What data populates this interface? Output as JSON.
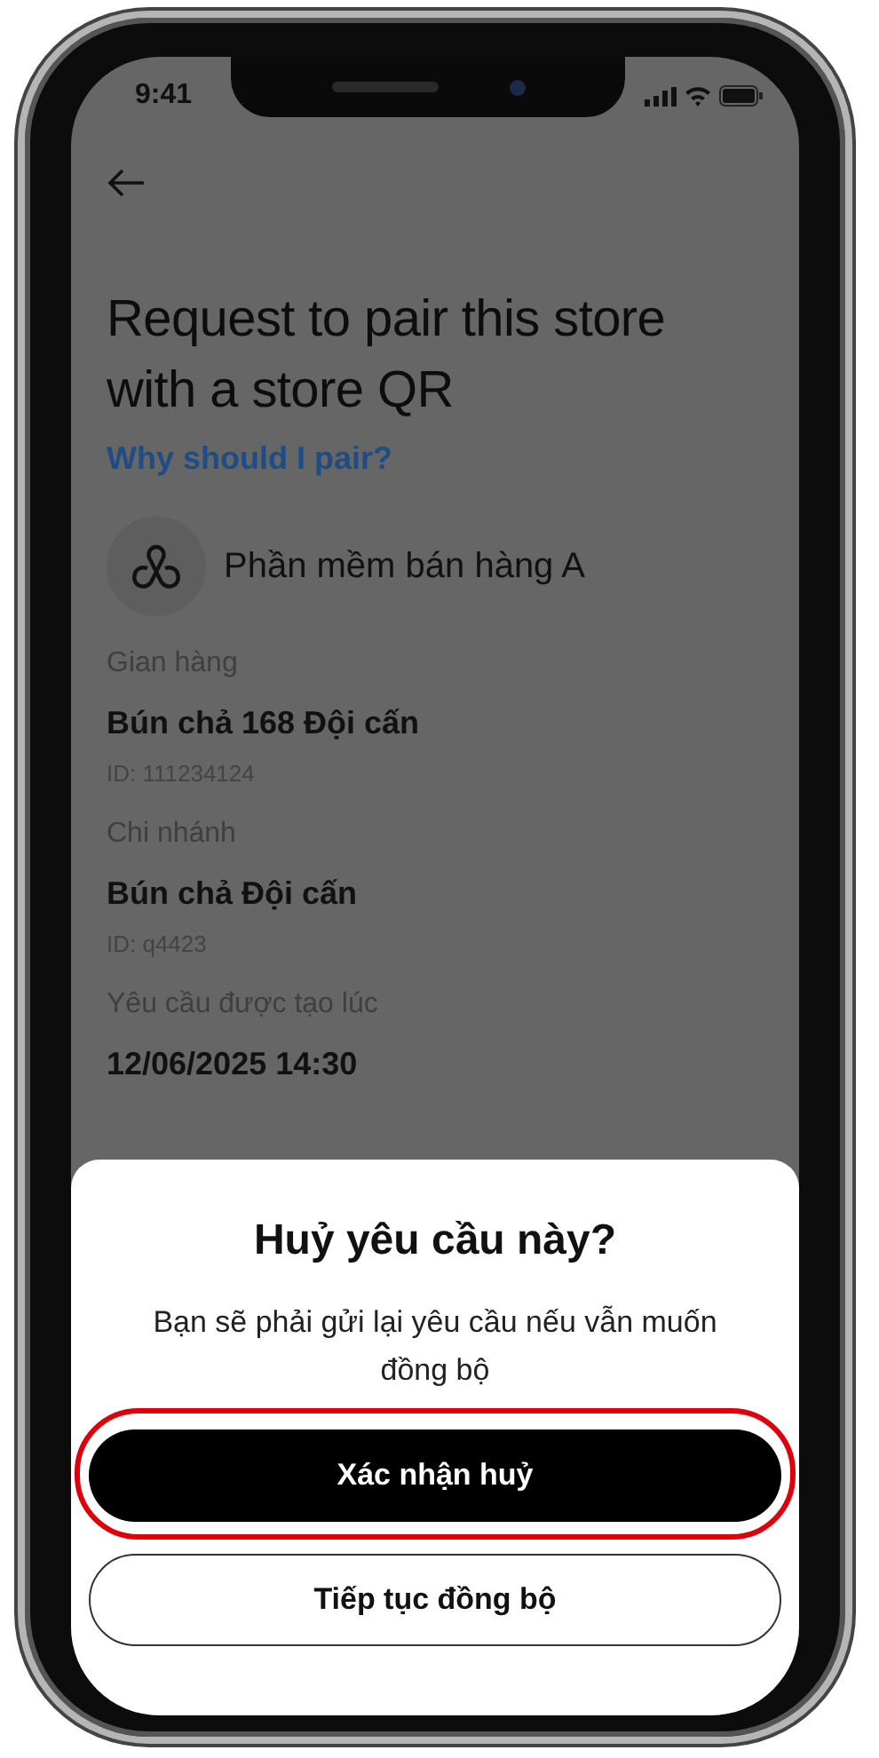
{
  "status_bar": {
    "time": "9:41"
  },
  "header": {
    "title": "Request to pair this store with a store QR",
    "link": "Why should I pair?"
  },
  "app": {
    "name": "Phần mềm bán hàng A"
  },
  "fields": [
    {
      "label": "Gian hàng",
      "value": "Bún chả 168 Đội cấn",
      "sub": "ID: 111234124"
    },
    {
      "label": "Chi nhánh",
      "value": "Bún chả Đội cấn",
      "sub": "ID: q4423"
    },
    {
      "label": "Yêu cầu được tạo lúc",
      "value": "12/06/2025 14:30"
    }
  ],
  "sheet": {
    "title": "Huỷ yêu cầu này?",
    "message": "Bạn sẽ phải gửi lại yêu cầu nếu vẫn muốn đồng bộ",
    "buttons": [
      {
        "label": "Xác nhận huỷ",
        "kind": "primary",
        "highlighted": true
      },
      {
        "label": "Tiếp tục đồng bộ",
        "kind": "secondary",
        "highlighted": false
      }
    ]
  }
}
